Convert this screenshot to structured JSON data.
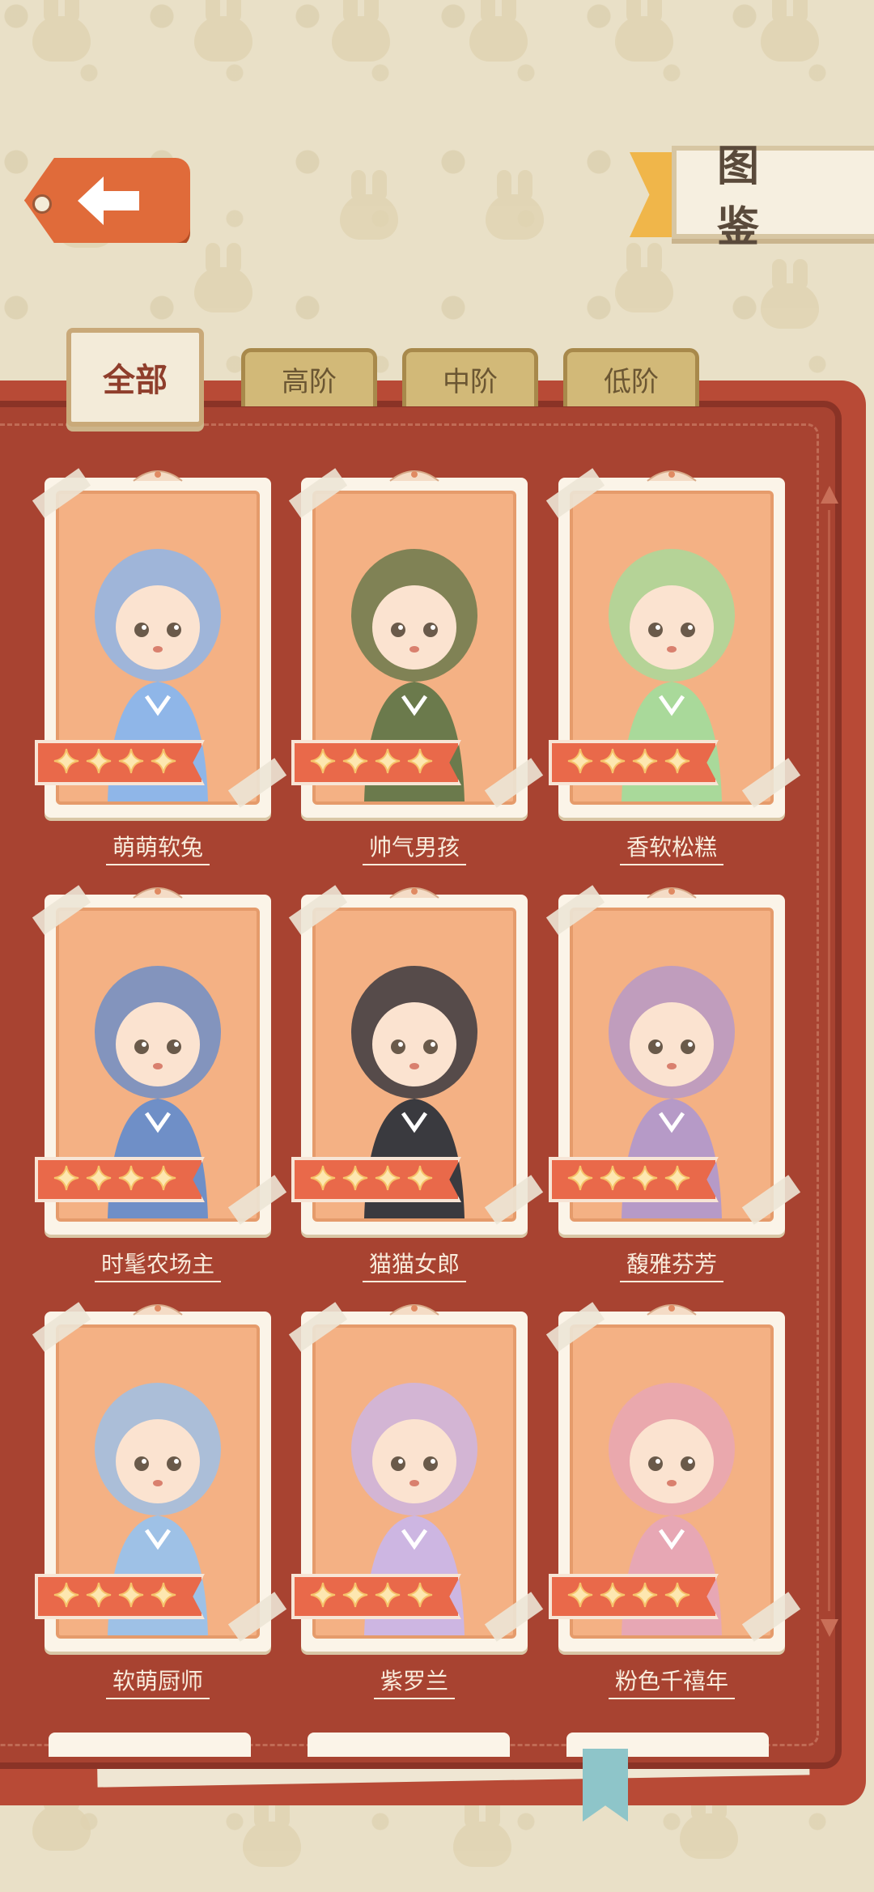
{
  "header": {
    "back_icon": "left-arrow-icon",
    "title": "图 鉴"
  },
  "tabs": [
    {
      "label": "全部",
      "active": true
    },
    {
      "label": "高阶",
      "active": false
    },
    {
      "label": "中阶",
      "active": false
    },
    {
      "label": "低阶",
      "active": false
    }
  ],
  "cards": [
    {
      "name": "萌萌软兔",
      "stars": 4,
      "theme": "#8fb6e8"
    },
    {
      "name": "帅气男孩",
      "stars": 4,
      "theme": "#6b7a4c"
    },
    {
      "name": "香软松糕",
      "stars": 4,
      "theme": "#a9d99a"
    },
    {
      "name": "时髦农场主",
      "stars": 4,
      "theme": "#6f8fc7"
    },
    {
      "name": "猫猫女郎",
      "stars": 4,
      "theme": "#3a3a3f"
    },
    {
      "name": "馥雅芬芳",
      "stars": 4,
      "theme": "#b69ac7"
    },
    {
      "name": "软萌厨师",
      "stars": 4,
      "theme": "#9ec1e6"
    },
    {
      "name": "紫罗兰",
      "stars": 4,
      "theme": "#cdb6e2"
    },
    {
      "name": "粉色千禧年",
      "stars": 4,
      "theme": "#e7a7b4"
    }
  ],
  "colors": {
    "book": "#a84331",
    "card_frame": "#f4b184",
    "star_strip": "#e9694a",
    "tab_active": "#f3ebd9",
    "tab_inactive": "#d2b978"
  }
}
